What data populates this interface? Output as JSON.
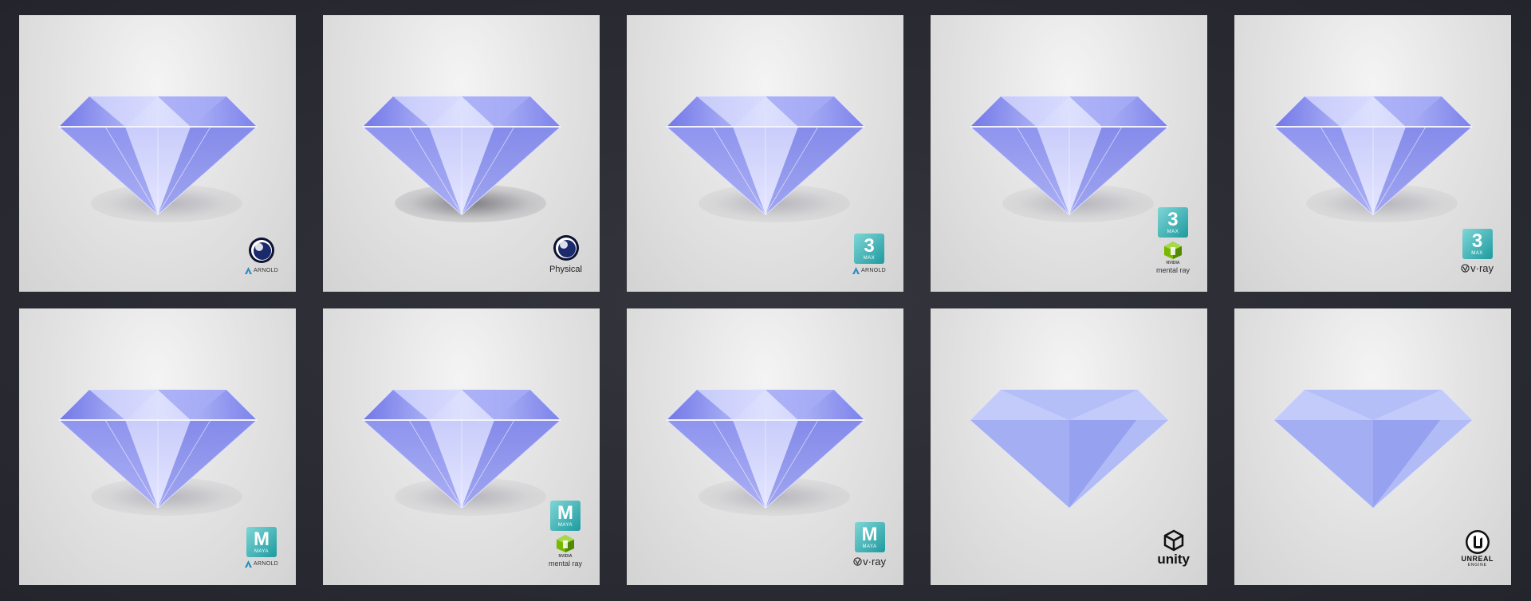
{
  "tiles": [
    {
      "id": "c4d-arnold",
      "logos": [
        "cinema4d-icon",
        "arnold-icon"
      ],
      "labels": {
        "arnold": "ARNOLD"
      }
    },
    {
      "id": "c4d-physical",
      "logos": [
        "cinema4d-icon"
      ],
      "labels": {
        "physical": "Physical"
      }
    },
    {
      "id": "max-arnold",
      "logos": [
        "3dsmax-icon",
        "arnold-icon"
      ],
      "labels": {
        "max_big": "3",
        "max_small": "MAX",
        "arnold": "ARNOLD"
      }
    },
    {
      "id": "max-mentalray",
      "logos": [
        "3dsmax-icon",
        "mentalray-icon"
      ],
      "labels": {
        "max_big": "3",
        "max_small": "MAX",
        "nvidia": "NVIDIA",
        "mentalray": "mental ray"
      }
    },
    {
      "id": "max-vray",
      "logos": [
        "3dsmax-icon",
        "vray-icon"
      ],
      "labels": {
        "max_big": "3",
        "max_small": "MAX",
        "vray": "v·ray"
      }
    },
    {
      "id": "maya-arnold",
      "logos": [
        "maya-icon",
        "arnold-icon"
      ],
      "labels": {
        "maya_big": "M",
        "maya_small": "MAYA",
        "arnold": "ARNOLD"
      }
    },
    {
      "id": "maya-mentalray",
      "logos": [
        "maya-icon",
        "mentalray-icon"
      ],
      "labels": {
        "maya_big": "M",
        "maya_small": "MAYA",
        "nvidia": "NVIDIA",
        "mentalray": "mental ray"
      }
    },
    {
      "id": "maya-vray",
      "logos": [
        "maya-icon",
        "vray-icon"
      ],
      "labels": {
        "maya_big": "M",
        "maya_small": "MAYA",
        "vray": "v·ray"
      }
    },
    {
      "id": "unity",
      "logos": [
        "unity-icon"
      ],
      "labels": {
        "unity": "unity"
      }
    },
    {
      "id": "unreal",
      "logos": [
        "unreal-icon"
      ],
      "labels": {
        "unreal1": "UNREAL",
        "unreal2": "ENGINE"
      }
    }
  ],
  "colors": {
    "gem_light": "#c7cdfb",
    "gem_mid": "#8f96f0",
    "gem_dark": "#5d63d8",
    "gem_flat": "#aab4f4",
    "background": "#2a2b33",
    "tile": "#e4e4e4"
  }
}
